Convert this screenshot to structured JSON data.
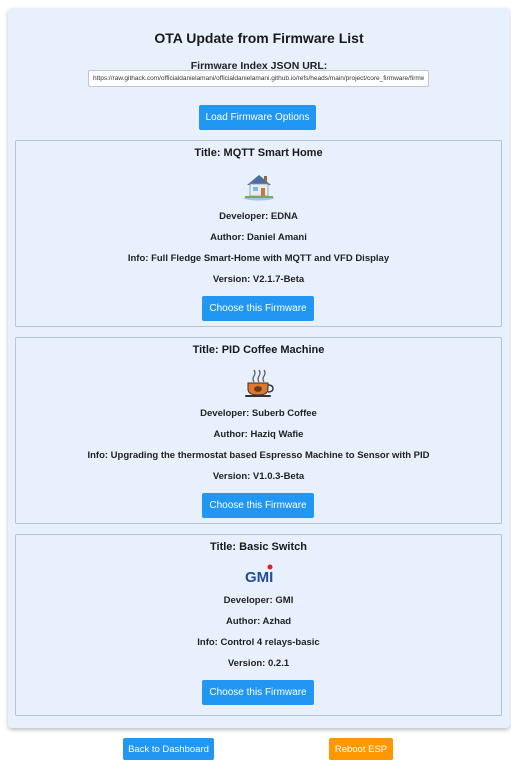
{
  "header": {
    "title": "OTA Update from Firmware List"
  },
  "url_field": {
    "label": "Firmware Index JSON URL:",
    "value": "https://raw.githack.com/officialdanielamani/officialdanielamani.github.io/refs/heads/main/project/core_firmware/firmware.json"
  },
  "load_button": {
    "label": "Load Firmware Options"
  },
  "firmwares": [
    {
      "title": "Title: MQTT Smart Home",
      "icon": "smart-home-icon",
      "developer": "Developer: EDNA",
      "author": "Author: Daniel Amani",
      "info": "Info: Full Fledge Smart-Home with MQTT and VFD Display",
      "version": "Version: V2.1.7-Beta",
      "button": "Choose this Firmware"
    },
    {
      "title": "Title: PID Coffee Machine",
      "icon": "coffee-cup-icon",
      "developer": "Developer: Suberb Coffee",
      "author": "Author: Haziq Wafie",
      "info": "Info: Upgrading the thermostat based Espresso Machine to Sensor with PID",
      "version": "Version: V1.0.3-Beta",
      "button": "Choose this Firmware"
    },
    {
      "title": "Title: Basic Switch",
      "icon": "gmi-logo-icon",
      "logo_text": "GMI",
      "developer": "Developer: GMI",
      "author": "Author: Azhad",
      "info": "Info: Control 4 relays-basic",
      "version": "Version: 0.2.1",
      "button": "Choose this Firmware"
    }
  ],
  "footer": {
    "back_label": "Back to Dashboard",
    "reboot_label": "Reboot ESP"
  },
  "colors": {
    "card_bg": "#e8f0fd",
    "primary_button": "#2196f3",
    "reboot_button": "#ff9800"
  }
}
